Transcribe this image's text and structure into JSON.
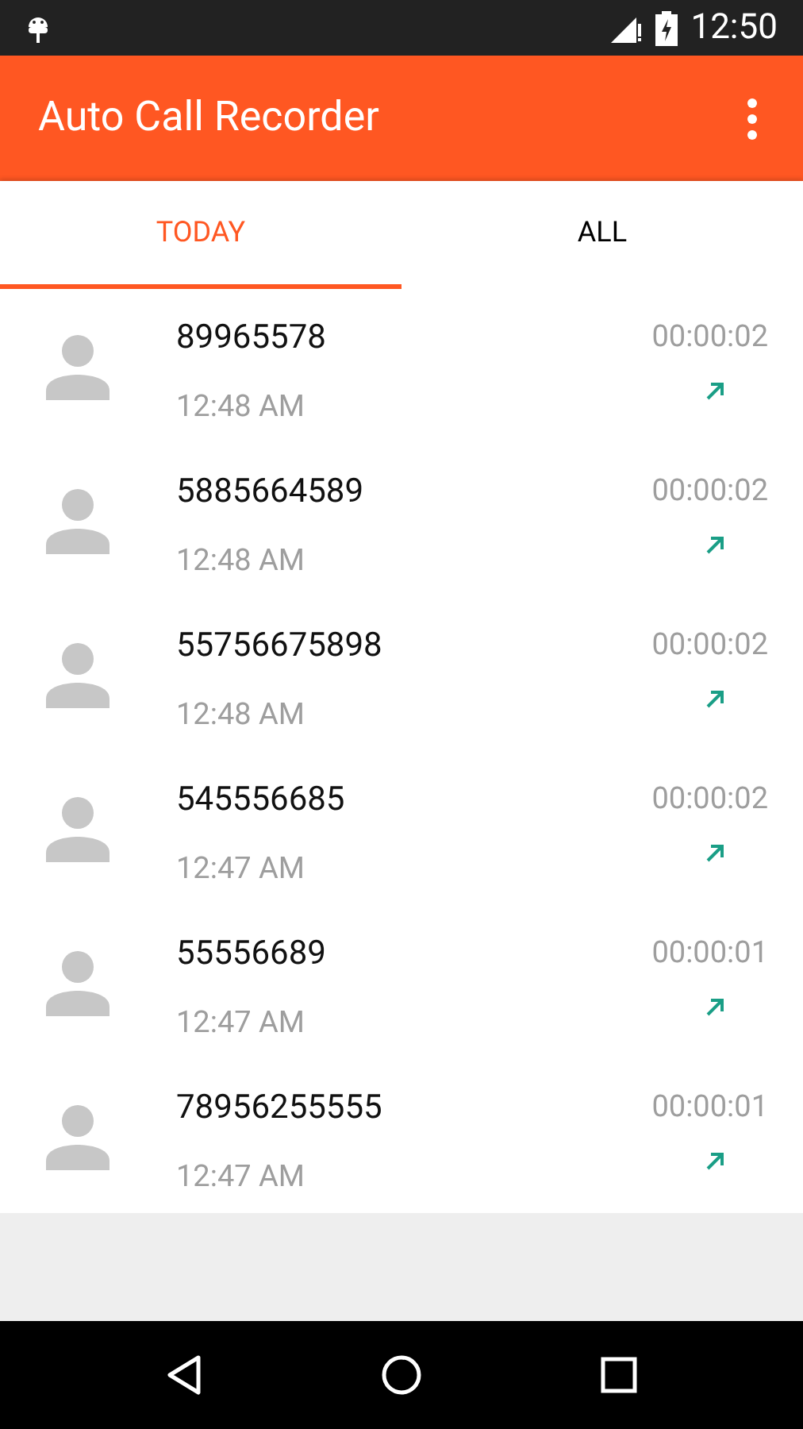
{
  "status_bar": {
    "time": "12:50"
  },
  "app_bar": {
    "title": "Auto Call Recorder"
  },
  "tabs": [
    {
      "label": "TODAY",
      "selected": true
    },
    {
      "label": "ALL",
      "selected": false
    }
  ],
  "calls": [
    {
      "number": "89965578",
      "time": "12:48 AM",
      "duration": "00:00:02",
      "kind": "outgoing"
    },
    {
      "number": "5885664589",
      "time": "12:48 AM",
      "duration": "00:00:02",
      "kind": "outgoing"
    },
    {
      "number": "55756675898",
      "time": "12:48 AM",
      "duration": "00:00:02",
      "kind": "outgoing"
    },
    {
      "number": "545556685",
      "time": "12:47 AM",
      "duration": "00:00:02",
      "kind": "outgoing"
    },
    {
      "number": "55556689",
      "time": "12:47 AM",
      "duration": "00:00:01",
      "kind": "outgoing"
    },
    {
      "number": "78956255555",
      "time": "12:47 AM",
      "duration": "00:00:01",
      "kind": "outgoing"
    }
  ]
}
